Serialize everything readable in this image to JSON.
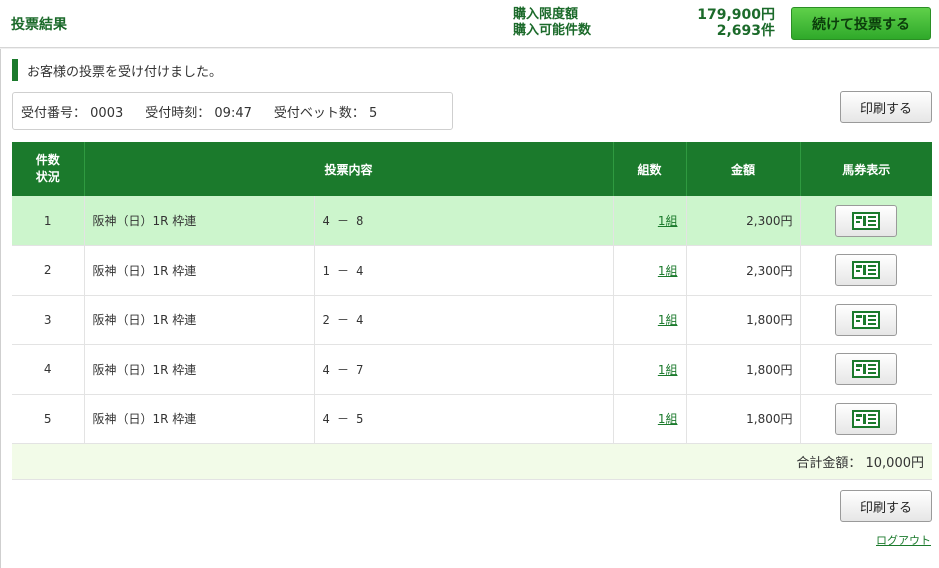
{
  "header": {
    "title": "投票結果",
    "limit_label": "購入限度額",
    "available_label": "購入可能件数",
    "limit_value": "179,900円",
    "available_value": "2,693件",
    "continue_button": "続けて投票する"
  },
  "notice": "お客様の投票を受け付けました。",
  "receipt": {
    "number_label": "受付番号：",
    "number_value": "0003",
    "time_label": "受付時刻：",
    "time_value": "09:47",
    "bets_label": "受付ベット数：",
    "bets_value": "5"
  },
  "print_button": "印刷する",
  "table": {
    "headers": {
      "no_line1": "件数",
      "no_line2": "状況",
      "content": "投票内容",
      "units": "組数",
      "amount": "金額",
      "ticket": "馬券表示"
    },
    "rows": [
      {
        "no": "1",
        "race": "阪神（日）1R 枠連",
        "combo": "4 － 8",
        "units": "1組",
        "amount": "2,300円"
      },
      {
        "no": "2",
        "race": "阪神（日）1R 枠連",
        "combo": "1 － 4",
        "units": "1組",
        "amount": "2,300円"
      },
      {
        "no": "3",
        "race": "阪神（日）1R 枠連",
        "combo": "2 － 4",
        "units": "1組",
        "amount": "1,800円"
      },
      {
        "no": "4",
        "race": "阪神（日）1R 枠連",
        "combo": "4 － 7",
        "units": "1組",
        "amount": "1,800円"
      },
      {
        "no": "5",
        "race": "阪神（日）1R 枠連",
        "combo": "4 － 5",
        "units": "1組",
        "amount": "1,800円"
      }
    ],
    "total": "合計金額： 10,000円"
  },
  "logout": "ログアウト",
  "icons": {
    "ticket": "ticket-view-icon"
  },
  "colors": {
    "brand_green": "#1b7a2c",
    "highlight_row": "#ccf5cc",
    "button_green": "#2fa92a"
  }
}
